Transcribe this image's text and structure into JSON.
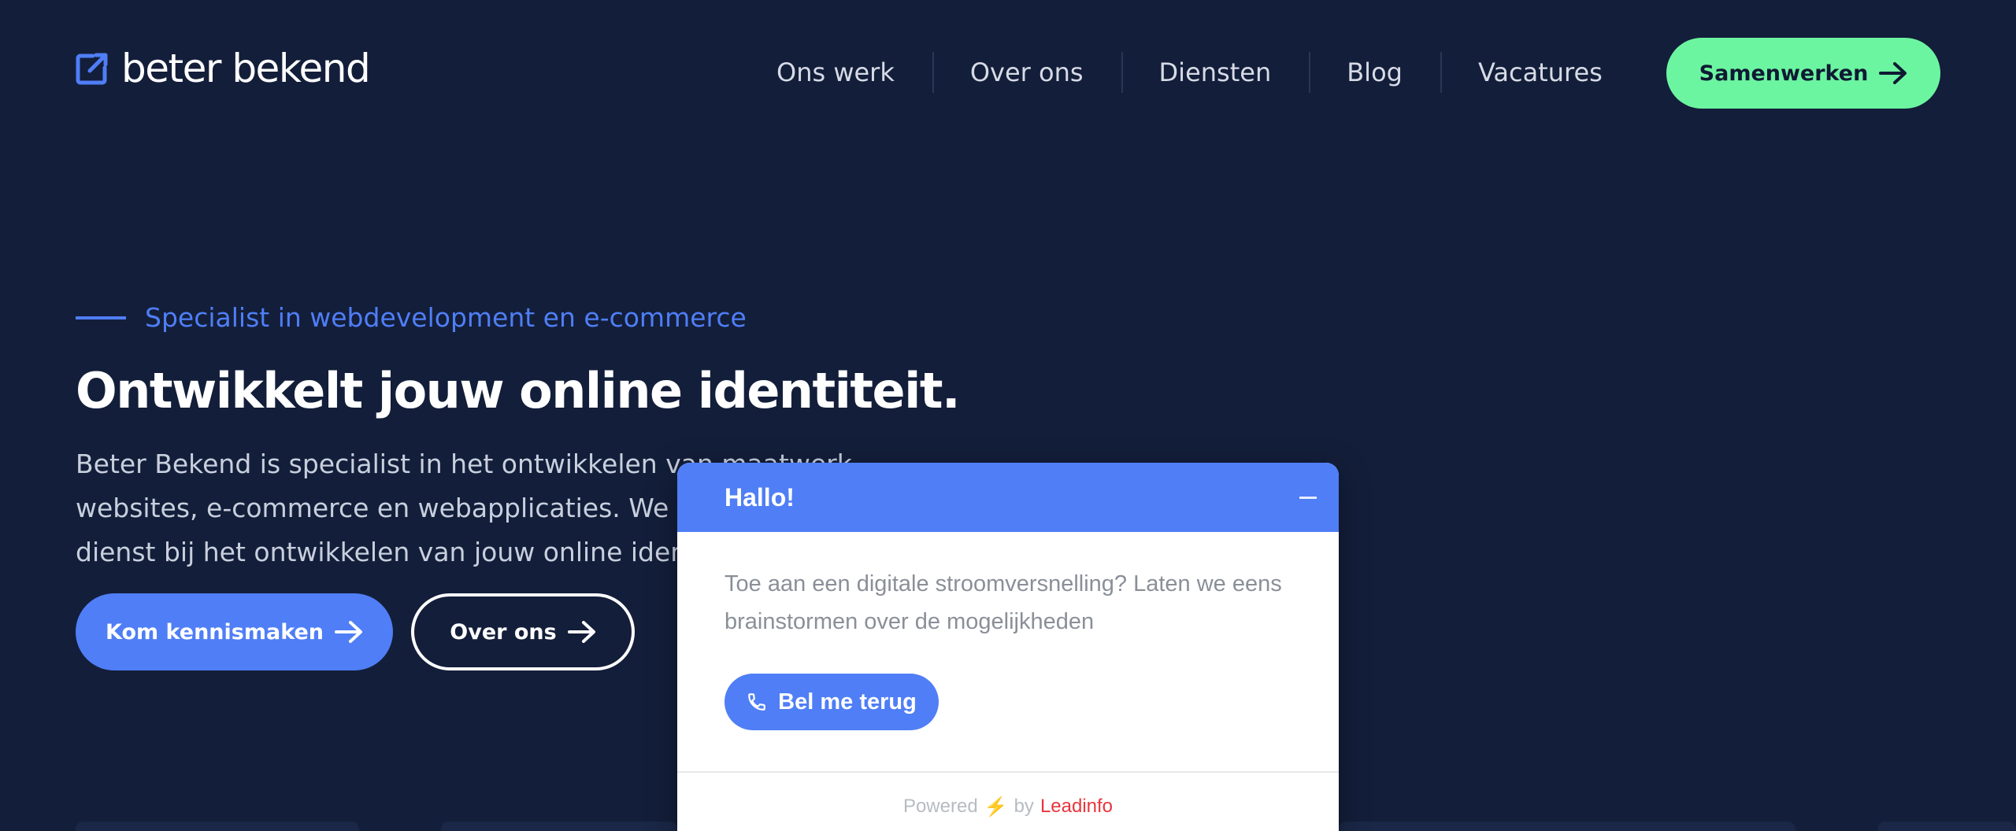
{
  "header": {
    "logo_text": "beter bekend",
    "nav": [
      "Ons werk",
      "Over ons",
      "Diensten",
      "Blog",
      "Vacatures"
    ],
    "cta_label": "Samenwerken"
  },
  "hero": {
    "eyebrow": "Specialist in webdevelopment en e-commerce",
    "title": "Ontwikkelt jouw online identiteit.",
    "body_lines": [
      "Beter Bekend is specialist in het ontwikkelen van maatwerk",
      "websites, e-commerce en webapplicaties. We zijn graag van",
      "dienst bij het ontwikkelen van jouw online identiteit."
    ],
    "primary_button": "Kom kennismaken",
    "secondary_button": "Over ons"
  },
  "chat": {
    "title": "Hallo!",
    "message": "Toe aan een digitale stroomversnelling? Laten we eens brainstormen over de mogelijkheden",
    "call_button": "Bel me terug",
    "powered": "Powered",
    "bolt": "⚡",
    "by": "by",
    "brand": "Leadinfo"
  },
  "colors": {
    "background": "#131e3a",
    "accent_blue": "#4f7ef6",
    "accent_green": "#6cf5a0",
    "leadinfo_red": "#e8353c"
  },
  "icons": {
    "logo": "external-link-icon",
    "arrow": "arrow-right-icon",
    "phone": "phone-icon",
    "minimize": "minimize-icon"
  }
}
